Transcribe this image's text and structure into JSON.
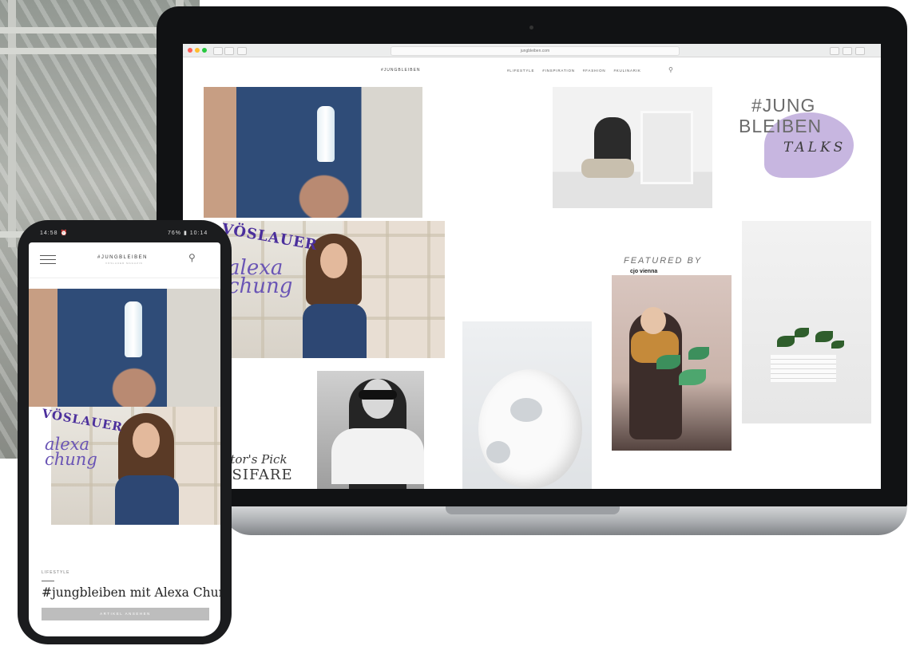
{
  "background": {
    "description_color": "#a3a7a1"
  },
  "laptop": {
    "browser": {
      "address": "jungbleiben.com",
      "traffic_lights": [
        "#ff5f57",
        "#ffbd2e",
        "#28c840"
      ]
    },
    "site": {
      "logo": "#JUNGBLEIBEN",
      "nav": [
        "#LIFESTYLE",
        "#INSPIRATION",
        "#FASHION",
        "#KULINARIK"
      ],
      "search_icon": "search-icon"
    },
    "tiles": {
      "jb_talks": {
        "line1": "#JUNG",
        "line2": "BLEIBEN",
        "script": "TALKS"
      },
      "voeslauer": "VÖSLAUER",
      "signature": [
        "alexa",
        "chung"
      ],
      "editors_pick": {
        "line1": "Editor's Pick",
        "line2": "MISIFARE"
      },
      "featured": {
        "label": "FEATURED BY",
        "brand": "cjo vienna"
      }
    }
  },
  "phone": {
    "status_left": "14:58 ⏰",
    "status_right": "76% ▮ 10:14",
    "logo": "#JUNGBLEIBEN",
    "logo_sub": "VÖSLAUER MAGAZIN",
    "search_icon": "search-icon",
    "menu_icon": "hamburger-icon",
    "voeslauer": "VÖSLAUER",
    "signature": [
      "alexa",
      "chung"
    ],
    "article": {
      "category": "LIFESTYLE",
      "title": "#jungbleiben mit Alexa Chung",
      "button": "ARTIKEL ANSEHEN"
    }
  },
  "colors": {
    "accent_purple": "#4b2f9c",
    "bubble_lilac": "#c7b6e0",
    "button_grey": "#bdbdbd"
  }
}
